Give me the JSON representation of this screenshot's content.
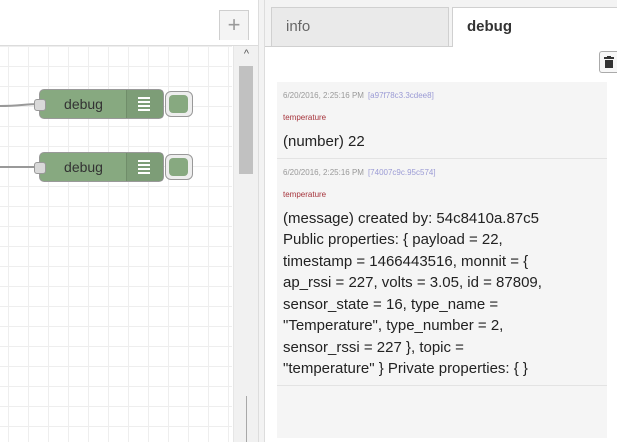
{
  "workspace": {
    "add_tab_label": "+",
    "scroll_up_glyph": "^",
    "nodes": [
      {
        "label": "debug",
        "icon": "debug-list-icon"
      },
      {
        "label": "debug",
        "icon": "debug-list-icon"
      }
    ]
  },
  "sidebar": {
    "tabs": [
      {
        "label": "info",
        "active": false
      },
      {
        "label": "debug",
        "active": true
      }
    ],
    "clear_icon": "trash-icon",
    "messages": [
      {
        "timestamp": "6/20/2016, 2:25:16 PM",
        "node_id": "[a97f78c3.3cdee8]",
        "topic": "temperature",
        "lines": [
          "(number) 22"
        ]
      },
      {
        "timestamp": "6/20/2016, 2:25:16 PM",
        "node_id": "[74007c9c.95c574]",
        "topic": "temperature",
        "lines": [
          "(message) created by: 54c8410a.87c5",
          "Public properties: { payload = 22,",
          "timestamp = 1466443516, monnit = {",
          "ap_rssi = 227, volts = 3.05, id = 87809,",
          "sensor_state = 16, type_name =",
          "\"Temperature\", type_number = 2,",
          "sensor_rssi = 227 }, topic =",
          "\"temperature\" } Private properties: { }"
        ]
      }
    ]
  },
  "colors": {
    "node_fill": "#87a980",
    "topic_text": "#a6343c",
    "node_id_text": "#9b9bd5"
  }
}
